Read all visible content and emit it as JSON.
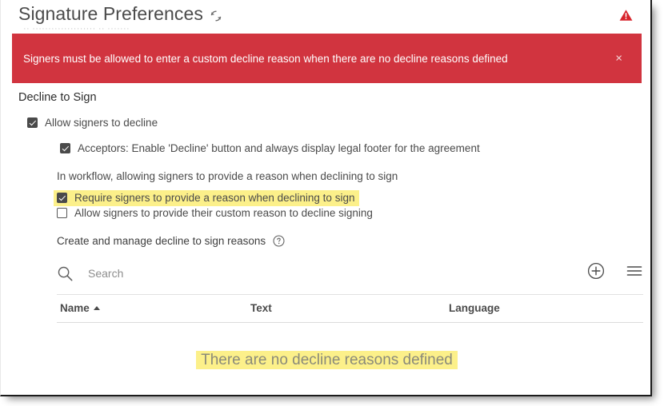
{
  "header": {
    "title": "Signature Preferences",
    "refresh_icon": "refresh-icon",
    "warning_icon": "warning-triangle-icon",
    "obscured_text": "··  ····················  ·· ·······"
  },
  "banner": {
    "message": "Signers must be allowed to enter a custom decline reason when there are no decline reasons defined",
    "close_label": "×",
    "color": "#d1343f",
    "text_color": "#ffffff"
  },
  "section": {
    "title": "Decline to Sign"
  },
  "options": [
    {
      "id": "allow-signers-to-decline",
      "label": "Allow signers to decline",
      "checked": true
    },
    {
      "id": "acceptors-enable-decline",
      "label": "Acceptors: Enable 'Decline' button and always display legal footer for the agreement",
      "checked": true
    },
    {
      "id": "require-reason",
      "label": "Require signers to provide a reason when declining to sign",
      "checked": true,
      "highlighted": true
    },
    {
      "id": "allow-custom-reason",
      "label": "Allow signers to provide their custom reason to decline signing",
      "checked": false
    }
  ],
  "workflow_note": "In workflow, allowing signers to provide a reason when declining to sign",
  "manage": {
    "label": "Create and manage decline to sign reasons",
    "help_icon": "help-question-icon"
  },
  "search": {
    "placeholder": "Search",
    "value": "",
    "icon": "search-icon"
  },
  "tools": {
    "add_icon": "add-circle-icon",
    "menu_icon": "hamburger-menu-icon"
  },
  "table": {
    "columns": [
      {
        "label": "Name",
        "sorted": "asc"
      },
      {
        "label": "Text",
        "sorted": "none"
      },
      {
        "label": "Language",
        "sorted": "none"
      }
    ],
    "rows": [],
    "empty_message": "There are no decline reasons defined",
    "highlight_color": "#fcf08a"
  }
}
